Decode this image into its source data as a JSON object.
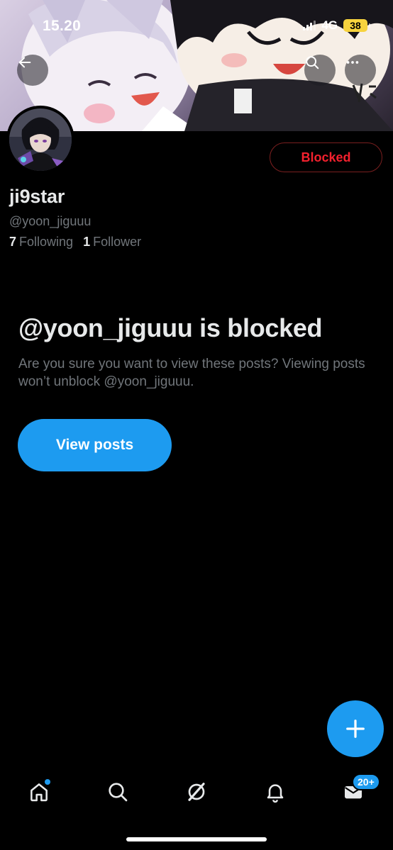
{
  "status_bar": {
    "time": "15.20",
    "network": "4G",
    "battery": "38"
  },
  "profile": {
    "display_name": "ji9star",
    "handle": "@yoon_jiguuu",
    "following_count": "7",
    "following_label": "Following",
    "followers_count": "1",
    "followers_label": "Follower",
    "blocked_button_label": "Blocked"
  },
  "notice": {
    "title": "@yoon_jiguuu is blocked",
    "description": "Are you sure you want to view these posts? Viewing posts won’t unblock @yoon_jiguuu.",
    "view_posts_label": "View posts"
  },
  "bottom_nav": {
    "messages_badge": "20+"
  },
  "colors": {
    "accent": "#1d9bf0",
    "blocked_red": "#f4212e",
    "muted_text": "#71767b",
    "background": "#000000",
    "battery_yellow": "#f7d33e"
  },
  "icons": {
    "back": "arrow-left-icon",
    "search": "search-icon",
    "more": "more-horizontal-icon",
    "compose": "plus-icon",
    "home": "home-icon",
    "explore": "search-icon",
    "grok": "grok-icon",
    "notifications": "bell-icon",
    "messages": "envelope-icon"
  }
}
